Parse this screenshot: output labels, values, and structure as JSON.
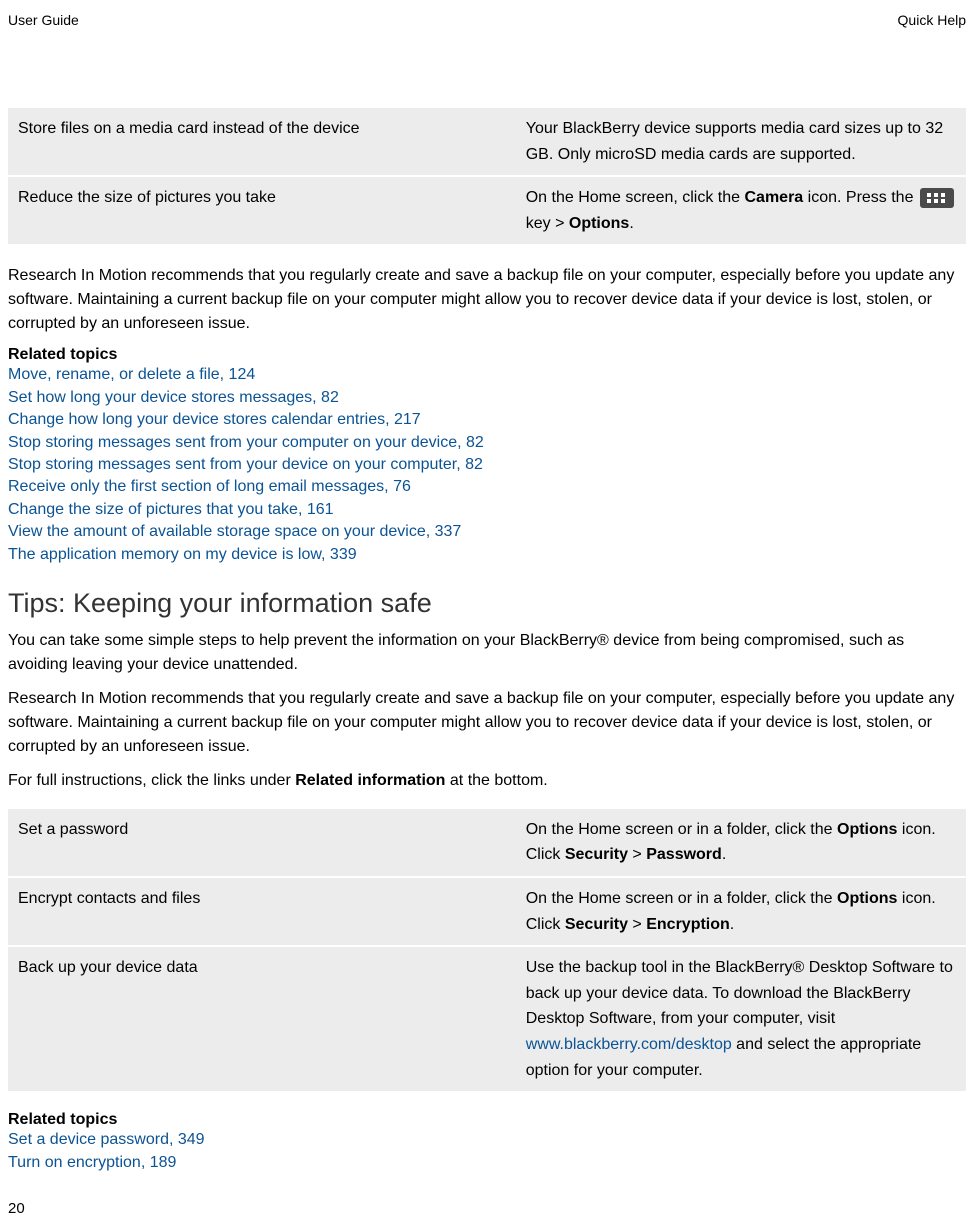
{
  "header": {
    "left": "User Guide",
    "right": "Quick Help"
  },
  "table1": {
    "row1_left": "Store files on a media card instead of the device",
    "row1_right": "Your BlackBerry device supports media card sizes up to 32 GB. Only microSD media cards are supported.",
    "row2_left": "Reduce the size of pictures you take",
    "row2_right_pre": "On the Home screen, click the ",
    "row2_right_b1": "Camera",
    "row2_right_mid": " icon. Press the ",
    "row2_right_post": " key > ",
    "row2_right_b2": "Options",
    "row2_right_end": "."
  },
  "para_research1": "Research In Motion recommends that you regularly create and save a backup file on your computer, especially before you update any software. Maintaining a current backup file on your computer might allow you to recover device data if your device is lost, stolen, or corrupted by an unforeseen issue.",
  "related_topics_heading": "Related topics",
  "links1": [
    "Move, rename, or delete a file, 124",
    "Set how long your device stores messages, 82",
    "Change how long your device stores calendar entries, 217",
    "Stop storing messages sent from your computer on your device, 82",
    "Stop storing messages sent from your device on your computer, 82",
    "Receive only the first section of long email messages, 76",
    "Change the size of pictures that you take, 161",
    "View the amount of available storage space on your device, 337",
    "The application memory on my device is low, 339"
  ],
  "section_title": "Tips: Keeping your information safe",
  "para_intro": "You can take some simple steps to help prevent the information on your BlackBerry® device from being compromised, such as avoiding leaving your device unattended.",
  "para_research2": "Research In Motion recommends that you regularly create and save a backup file on your computer, especially before you update any software. Maintaining a current backup file on your computer might allow you to recover device data if your device is lost, stolen, or corrupted by an unforeseen issue.",
  "para_instructions_pre": "For full instructions, click the links under ",
  "para_instructions_b": "Related information",
  "para_instructions_post": " at the bottom.",
  "table2": {
    "r1_left": "Set a password",
    "r1_right_pre": "On the Home screen or in a folder, click the ",
    "r1_right_b1": "Options",
    "r1_right_mid": " icon. Click ",
    "r1_right_b2": "Security",
    "r1_right_gt": " > ",
    "r1_right_b3": "Password",
    "r1_right_end": ".",
    "r2_left": "Encrypt contacts and files",
    "r2_right_pre": "On the Home screen or in a folder, click the ",
    "r2_right_b1": "Options",
    "r2_right_mid": " icon. Click ",
    "r2_right_b2": "Security",
    "r2_right_gt": " > ",
    "r2_right_b3": "Encryption",
    "r2_right_end": ".",
    "r3_left": "Back up your device data",
    "r3_right_pre": "Use the backup tool in the BlackBerry® Desktop Software to back up your device data. To download the BlackBerry Desktop Software, from your computer, visit ",
    "r3_right_link": "www.blackberry.com/desktop",
    "r3_right_post": " and select the appropriate option for your computer."
  },
  "links2": [
    "Set a device password, 349",
    "Turn on encryption, 189"
  ],
  "page_number": "20"
}
